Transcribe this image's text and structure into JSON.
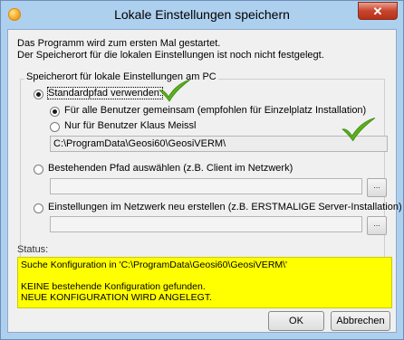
{
  "window": {
    "title": "Lokale Einstellungen speichern",
    "close_glyph": "✕"
  },
  "intro": {
    "line1": "Das Programm wird zum ersten Mal gestartet.",
    "line2": "Der Speicherort für die lokalen Einstellungen ist noch nicht festgelegt."
  },
  "group": {
    "legend": "Speicherort für lokale Einstellungen am PC",
    "option_standard": "Standardpfad verwenden:",
    "sub_all_users": "Für alle Benutzer gemeinsam (empfohlen für Einzelplatz Installation)",
    "sub_user_only": "Nur für Benutzer Klaus Meissl",
    "standard_path_value": "C:\\ProgramData\\Geosi60\\GeosiVERM\\",
    "option_existing": "Bestehenden Pfad auswählen (z.B. Client im Netzwerk)",
    "existing_path_value": "",
    "option_network": "Einstellungen im Netzwerk neu erstellen (z.B. ERSTMALIGE Server-Installation)",
    "network_path_value": "",
    "browse_label": "..."
  },
  "status": {
    "label": "Status:",
    "line1": "Suche Konfiguration in 'C:\\ProgramData\\Geosi60\\GeosiVERM\\'",
    "line2": "",
    "line3": "KEINE bestehende Konfiguration gefunden.",
    "line4": "NEUE KONFIGURATION WIRD ANGELEGT."
  },
  "buttons": {
    "ok": "OK",
    "cancel": "Abbrechen"
  },
  "colors": {
    "status_bg": "#ffff00",
    "checkmark": "#5dae1e",
    "title_bg": "#aed0ef"
  },
  "icons": [
    "app-icon",
    "close-icon",
    "checkmark-icon"
  ]
}
